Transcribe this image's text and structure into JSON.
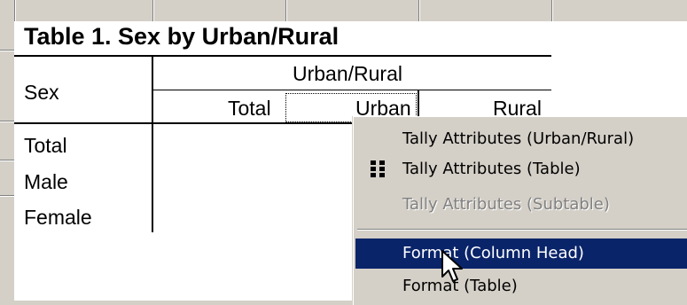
{
  "table": {
    "title": "Table 1. Sex by Urban/Rural",
    "row_header": "Sex",
    "column_group": "Urban/Rural",
    "columns": [
      "Total",
      "Urban",
      "Rural"
    ],
    "rows": [
      "Total",
      "Male",
      "Female"
    ]
  },
  "context_menu": {
    "items": [
      {
        "label": "Tally Attributes (Urban/Rural)",
        "state": "enabled",
        "icon": ""
      },
      {
        "label": "Tally Attributes (Table)",
        "state": "enabled",
        "icon": "grid-icon"
      },
      {
        "label": "Tally Attributes (Subtable)",
        "state": "disabled",
        "icon": ""
      },
      {
        "label": "Format (Column Head)",
        "state": "selected",
        "icon": ""
      },
      {
        "label": "Format (Table)",
        "state": "enabled",
        "icon": ""
      }
    ]
  },
  "colors": {
    "sheet_bg": "#ffffff",
    "chrome_bg": "#d4d0c8",
    "selection": "#0a246a",
    "disabled_text": "#808080"
  },
  "cursor": "arrow-cursor-icon"
}
